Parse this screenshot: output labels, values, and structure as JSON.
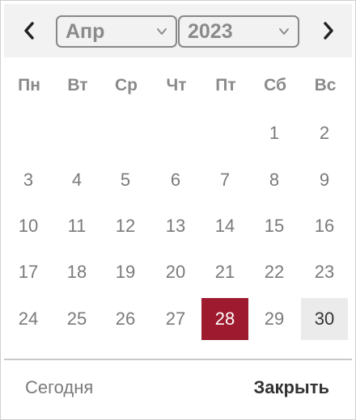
{
  "header": {
    "month_selected": "Апр",
    "year_selected": "2023",
    "prev_icon": "chevron-left-icon",
    "next_icon": "chevron-right-icon"
  },
  "weekdays": [
    "Пн",
    "Вт",
    "Ср",
    "Чт",
    "Пт",
    "Сб",
    "Вс"
  ],
  "weeks": [
    [
      "",
      "",
      "",
      "",
      "",
      "1",
      "2"
    ],
    [
      "3",
      "4",
      "5",
      "6",
      "7",
      "8",
      "9"
    ],
    [
      "10",
      "11",
      "12",
      "13",
      "14",
      "15",
      "16"
    ],
    [
      "17",
      "18",
      "19",
      "20",
      "21",
      "22",
      "23"
    ],
    [
      "24",
      "25",
      "26",
      "27",
      "28",
      "29",
      "30"
    ]
  ],
  "selected_day": "28",
  "today_day": "30",
  "footer": {
    "today_label": "Сегодня",
    "close_label": "Закрыть"
  },
  "colors": {
    "selected_bg": "#9e1b2f",
    "today_bg": "#ebebeb",
    "header_bg": "#f2f2f2"
  }
}
